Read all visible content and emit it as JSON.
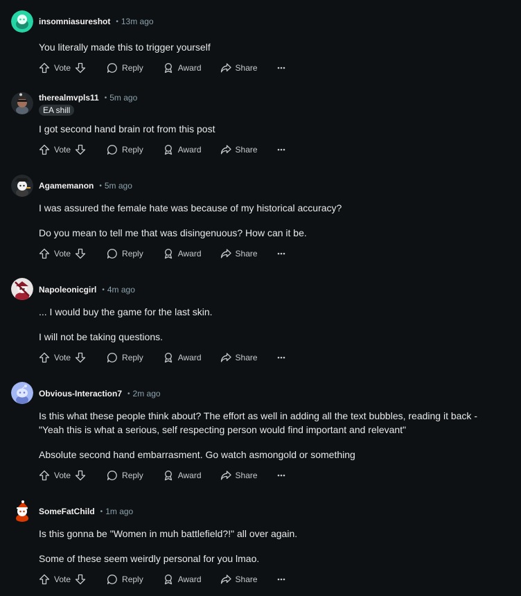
{
  "comments": [
    {
      "username": "insomniasureshot",
      "time": "13m ago",
      "flair": "",
      "paragraphs": [
        "You literally made this to trigger yourself"
      ],
      "avatar": "avatar-teal-snoo"
    },
    {
      "username": "therealmvpls11",
      "time": "5m ago",
      "flair": "EA shill",
      "paragraphs": [
        "I got second hand brain rot from this post"
      ],
      "avatar": "avatar-dark-snoo"
    },
    {
      "username": "Agamemanon",
      "time": "5m ago",
      "flair": "",
      "paragraphs": [
        "I was assured the female hate was because of my historical accuracy?",
        "Do you mean to tell me that was disingenuous? How can it be."
      ],
      "avatar": "avatar-hat-snoo"
    },
    {
      "username": "Napoleonicgirl",
      "time": "4m ago",
      "flair": "",
      "paragraphs": [
        "... I would buy the game for the last skin.",
        "I will not be taking questions."
      ],
      "avatar": "avatar-red-snoo"
    },
    {
      "username": "Obvious-Interaction7",
      "time": "2m ago",
      "flair": "",
      "paragraphs": [
        "Is this what these people think about? The effort as well in adding all the text bubbles, reading it back - \"Yeah this is what a serious, self respecting person would find important and relevant\"",
        "Absolute second hand embarrasment. Go watch asmongold or something"
      ],
      "avatar": "avatar-default-snoo"
    },
    {
      "username": "SomeFatChild",
      "time": "1m ago",
      "flair": "",
      "paragraphs": [
        "Is this gonna be \"Women in muh battlefield?!\" all over again.",
        "Some of these seem weirdly personal for you lmao."
      ],
      "avatar": "avatar-santa-snoo"
    }
  ],
  "actions": {
    "vote": "Vote",
    "reply": "Reply",
    "award": "Award",
    "share": "Share"
  },
  "dot": "•",
  "colors": {
    "background": "#0e1113",
    "text": "#e8eaeb",
    "muted": "#8ba2ad",
    "flair_bg": "#2a3236"
  }
}
